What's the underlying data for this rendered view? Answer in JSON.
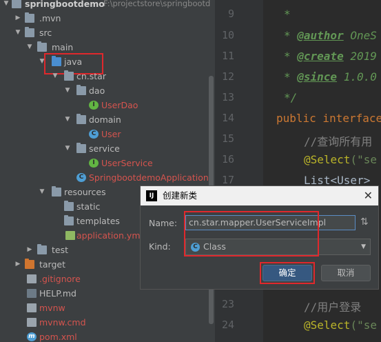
{
  "tree": {
    "root_label": "springbootdemo",
    "root_path": "F:\\projectstore\\springbootd",
    "items": {
      "mvn": ".mvn",
      "src": "src",
      "main": "main",
      "java": "java",
      "pkg": "cn.star",
      "dao": "dao",
      "userdao": "UserDao",
      "domain": "domain",
      "user": "User",
      "service": "service",
      "userservice": "UserService",
      "app": "SpringbootdemoApplication",
      "resources": "resources",
      "static": "static",
      "templates": "templates",
      "appyml": "application.yml",
      "test": "test",
      "target": "target",
      "gitignore": ".gitignore",
      "help": "HELP.md",
      "mvnw": "mvnw",
      "mvnwcmd": "mvnw.cmd",
      "pom": "pom.xml"
    }
  },
  "editor": {
    "line_numbers": [
      "9",
      "10",
      "11",
      "12",
      "13",
      "14",
      "15",
      "16",
      "17",
      "23",
      "24"
    ],
    "lines": {
      "l9": "*",
      "l10_star": "* ",
      "l10_tag": "@author",
      "l10_rest": " OneS",
      "l11_star": "* ",
      "l11_tag": "@create",
      "l11_rest": " 2019",
      "l12_star": "* ",
      "l12_tag": "@since",
      "l12_rest": " 1.0.0",
      "l13": "*/",
      "l14_kw": "public interface",
      "l15": "//查询所有用",
      "l16_anno": "@Select",
      "l16_rest": "(\"se",
      "l17": "List<User>",
      "l23": "//用户登录",
      "l24_anno": "@Select",
      "l24_rest": "(\"se"
    }
  },
  "dialog": {
    "title": "创建新类",
    "close": "✕",
    "logo": "IJ",
    "name_label": "Name:",
    "name_value": "cn.star.mapper.UserServiceImpl",
    "kind_label": "Kind:",
    "kind_value": "Class",
    "kind_icon": "C",
    "sort_icon": "⇅",
    "ok_label": "确定",
    "cancel_label": "取消"
  }
}
